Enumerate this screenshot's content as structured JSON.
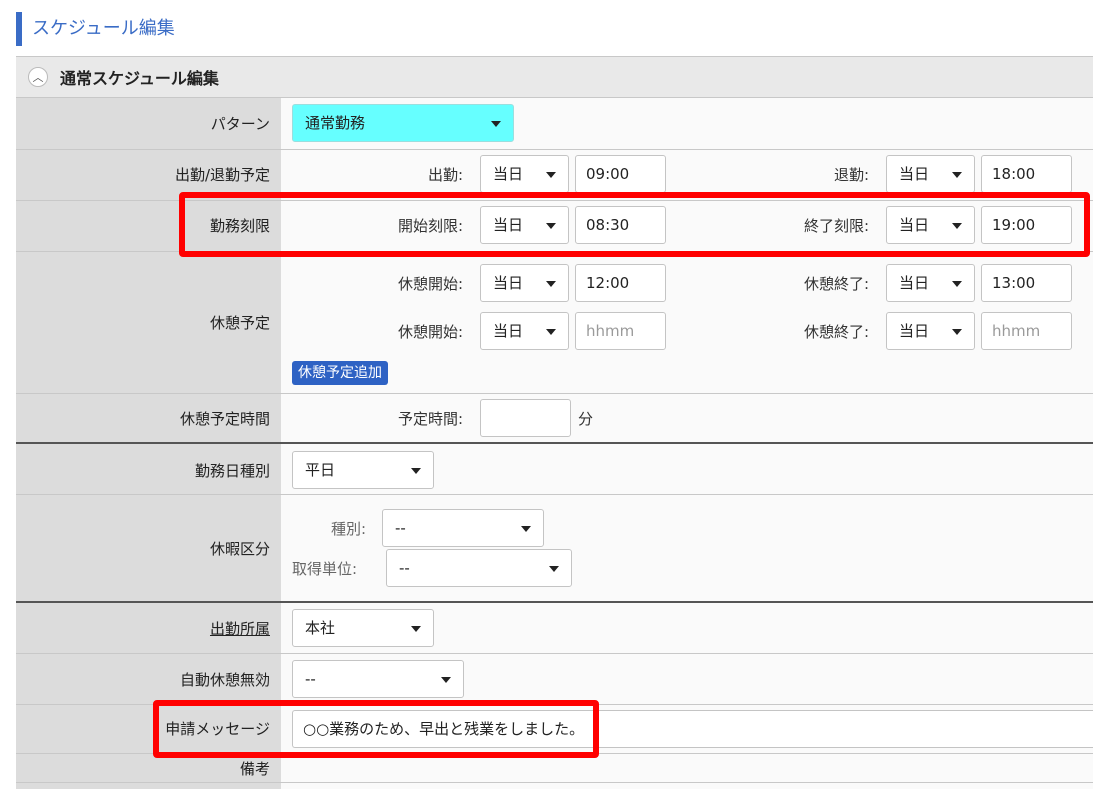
{
  "page": {
    "title": "スケジュール編集"
  },
  "section": {
    "title": "通常スケジュール編集"
  },
  "rows": {
    "pattern": {
      "label": "パターン",
      "value": "通常勤務"
    },
    "attendance": {
      "label": "出勤/退勤予定",
      "start_label": "出勤:",
      "start_day": "当日",
      "start_time": "09:00",
      "end_label": "退勤:",
      "end_day": "当日",
      "end_time": "18:00"
    },
    "work_limit": {
      "label": "勤務刻限",
      "start_label": "開始刻限:",
      "start_day": "当日",
      "start_time": "08:30",
      "end_label": "終了刻限:",
      "end_day": "当日",
      "end_time": "19:00"
    },
    "break_schedule": {
      "label": "休憩予定",
      "breaks": [
        {
          "start_label": "休憩開始:",
          "start_day": "当日",
          "start_time": "12:00",
          "end_label": "休憩終了:",
          "end_day": "当日",
          "end_time": "13:00"
        },
        {
          "start_label": "休憩開始:",
          "start_day": "当日",
          "start_placeholder": "hhmm",
          "end_label": "休憩終了:",
          "end_day": "当日",
          "end_placeholder": "hhmm"
        }
      ],
      "add_button": "休憩予定追加"
    },
    "break_time": {
      "label": "休憩予定時間",
      "field_label": "予定時間:",
      "value": "",
      "unit": "分"
    },
    "day_type": {
      "label": "勤務日種別",
      "value": "平日"
    },
    "leave": {
      "label": "休暇区分",
      "type_label": "種別:",
      "type_value": "--",
      "unit_label": "取得単位:",
      "unit_value": "--"
    },
    "office": {
      "label": "出勤所属",
      "value": "本社"
    },
    "auto_break": {
      "label": "自動休憩無効",
      "value": "--"
    },
    "message": {
      "label": "申請メッセージ",
      "value": "○○業務のため、早出と残業をしました。"
    },
    "remarks": {
      "label": "備考"
    }
  },
  "colors": {
    "accent": "#3a6cc6",
    "highlight": "#ff0000",
    "pattern_select": "#66ffff"
  }
}
